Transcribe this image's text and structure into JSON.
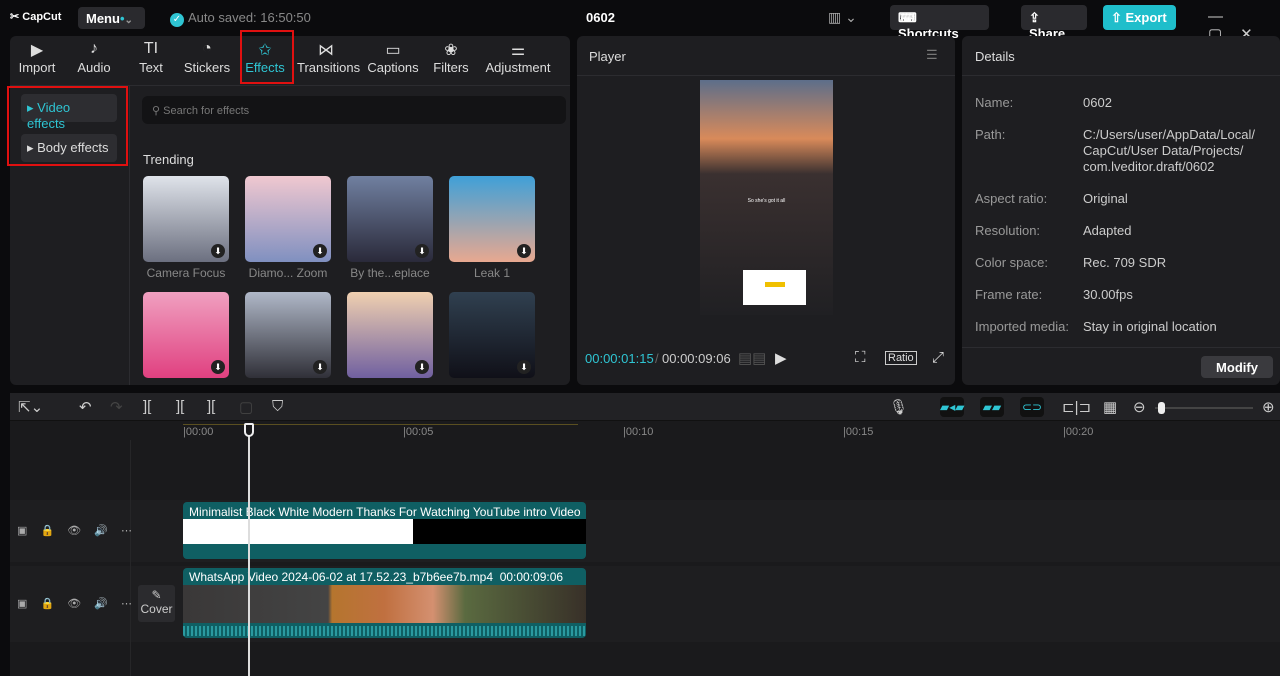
{
  "topbar": {
    "logo": "CapCut",
    "menu": "Menu",
    "autosave": "Auto saved: 16:50:50",
    "project_title": "0602",
    "shortcuts": "Shortcuts",
    "share": "Share",
    "export": "Export"
  },
  "tabs": [
    {
      "label": "Import",
      "icon": "▶"
    },
    {
      "label": "Audio",
      "icon": "♪"
    },
    {
      "label": "Text",
      "icon": "TI"
    },
    {
      "label": "Stickers",
      "icon": "◔"
    },
    {
      "label": "Effects",
      "icon": "✩"
    },
    {
      "label": "Transitions",
      "icon": "⋈"
    },
    {
      "label": "Captions",
      "icon": "▭"
    },
    {
      "label": "Filters",
      "icon": "❀"
    },
    {
      "label": "Adjustment",
      "icon": "⚌"
    }
  ],
  "sidebar": {
    "video_effects": "Video effects",
    "body_effects": "Body effects"
  },
  "search": {
    "placeholder": "Search for effects"
  },
  "trending": {
    "heading": "Trending",
    "items": [
      {
        "label": "Camera Focus"
      },
      {
        "label": "Diamo... Zoom"
      },
      {
        "label": "By the...eplace"
      },
      {
        "label": "Leak 1"
      },
      {
        "label": ""
      },
      {
        "label": ""
      },
      {
        "label": ""
      },
      {
        "label": ""
      }
    ]
  },
  "player": {
    "title": "Player",
    "overlay_text": "So she's got it all",
    "current_time": "00:00:01:15",
    "total_time": "00:00:09:06",
    "ratio": "Ratio"
  },
  "details": {
    "title": "Details",
    "rows": [
      {
        "label": "Name:",
        "value": "0602"
      },
      {
        "label": "Path:",
        "value": "C:/Users/user/AppData/Local/ CapCut/User Data/Projects/ com.lveditor.draft/0602"
      },
      {
        "label": "Aspect ratio:",
        "value": "Original"
      },
      {
        "label": "Resolution:",
        "value": "Adapted"
      },
      {
        "label": "Color space:",
        "value": "Rec. 709 SDR"
      },
      {
        "label": "Frame rate:",
        "value": "30.00fps"
      },
      {
        "label": "Imported media:",
        "value": "Stay in original location"
      }
    ],
    "modify": "Modify"
  },
  "timeline": {
    "ticks": [
      "00:00",
      "00:05",
      "00:10",
      "00:15",
      "00:20"
    ],
    "cover": "Cover",
    "clip1": {
      "title": "Minimalist Black White Modern Thanks For Watching YouTube intro Video"
    },
    "clip2": {
      "title": "WhatsApp Video 2024-06-02 at 17.52.23_b7b6ee7b.mp4",
      "duration": "00:00:09:06"
    }
  },
  "colors": {
    "accent": "#2fc5d3",
    "highlight": "#e01010",
    "clip": "#0f5f63"
  }
}
